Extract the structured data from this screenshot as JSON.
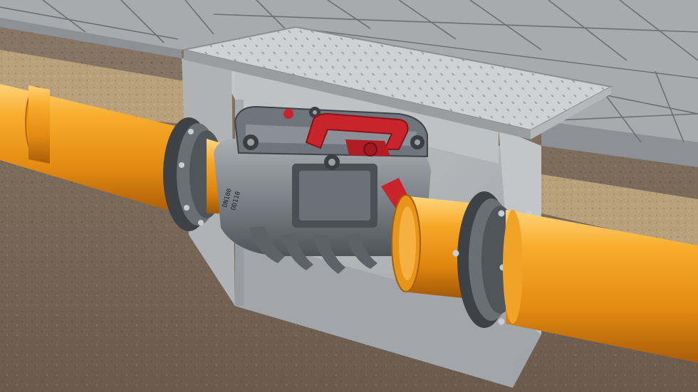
{
  "scene": {
    "subject": "backwater-valve-in-chamber",
    "colors": {
      "pipe": "#f2a01f",
      "pipe_dark": "#c9720f",
      "pipe_light": "#ffc65a",
      "valve_body": "#8d9399",
      "valve_dark": "#5a5f66",
      "handle": "#c9232b",
      "concrete": "#b9bcbf",
      "concrete_dark": "#8f9397",
      "tile": "#a9acae",
      "soil": "#7a6a5a",
      "sand": "#b49c78",
      "cover": "#cfd1d2"
    },
    "valve": {
      "body_markings": [
        "DN100",
        "OD110"
      ],
      "handle_markings": [
        "",
        ""
      ]
    }
  }
}
